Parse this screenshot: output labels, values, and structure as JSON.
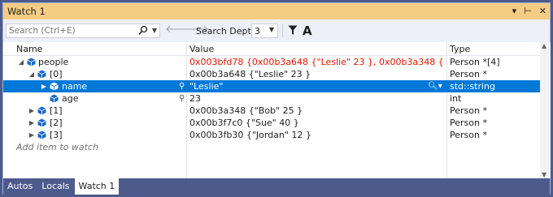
{
  "window": {
    "title": "Watch 1",
    "buttons": {
      "menu": "▾",
      "pin": "⊢",
      "close": "✕"
    }
  },
  "toolbar": {
    "search_placeholder": "Search (Ctrl+E)",
    "search_depth_label": "Search Depth:",
    "search_depth_value": "3",
    "font_glyph": "A"
  },
  "grid": {
    "columns": {
      "name": "Name",
      "value": "Value",
      "type": "Type"
    },
    "rows": [
      {
        "name": "people",
        "value": "0x003bfd78 {0x00b3a648 {\"Leslie\" 23 }, 0x00b3a348 {\"Bob\" 25 }, 0x00…",
        "type": "Person *[4]",
        "expander": "◢"
      },
      {
        "name": "[0]",
        "value": "0x00b3a648 {\"Leslie\" 23 }",
        "type": "Person *",
        "expander": "◢"
      },
      {
        "name": "name",
        "value": "\"Leslie\"",
        "type": "std::string",
        "expander": "▶"
      },
      {
        "name": "age",
        "value": "23",
        "type": "int",
        "expander": ""
      },
      {
        "name": "[1]",
        "value": "0x00b3a348 {\"Bob\" 25 }",
        "type": "Person *",
        "expander": "▶"
      },
      {
        "name": "[2]",
        "value": "0x00b3f7c0 {\"Sue\" 40 }",
        "type": "Person *",
        "expander": "▶"
      },
      {
        "name": "[3]",
        "value": "0x00b3fb30 {\"Jordan\" 12 }",
        "type": "Person *",
        "expander": "▶"
      }
    ],
    "add_item": "Add item to watch"
  },
  "tabs": [
    {
      "label": "Autos",
      "active": false
    },
    {
      "label": "Locals",
      "active": false
    },
    {
      "label": "Watch 1",
      "active": true
    }
  ],
  "colors": {
    "titlebar": "#f5cc84",
    "selection": "#0078d7",
    "changed_value": "#e51400",
    "tab_strip": "#4d5a8c"
  }
}
